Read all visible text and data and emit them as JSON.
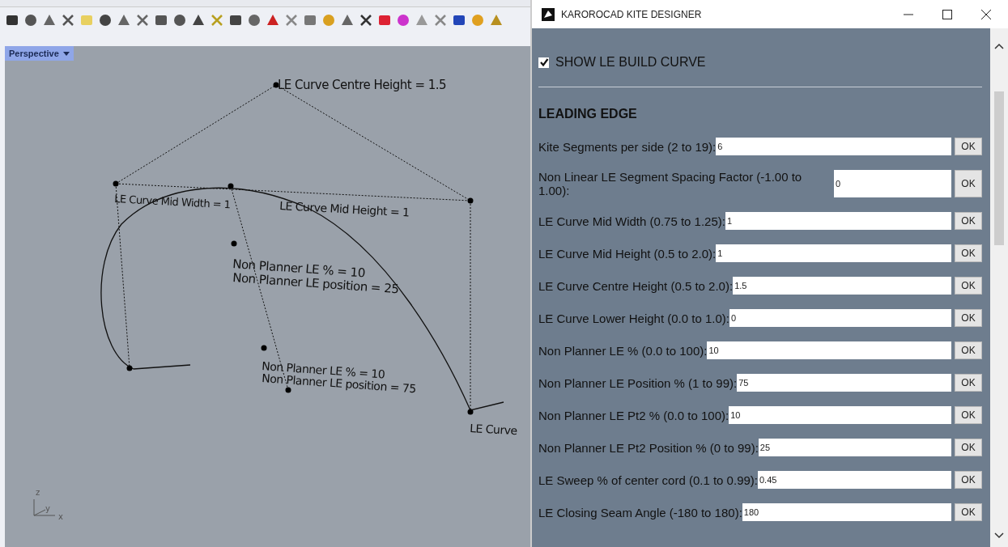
{
  "viewport": {
    "tab": "Perspective",
    "labels": [
      "LE Curve Centre Height = 1.5",
      "LE Curve Mid Width = 1",
      "LE Curve Mid Height = 1",
      "Non Planner LE % = 10",
      "Non Planner LE position = 25",
      "Non Planner LE % = 10",
      "Non Planner LE position = 75",
      "LE Curve"
    ],
    "axes": {
      "z": "z",
      "y": "y",
      "x": "x"
    }
  },
  "dialog": {
    "title": "KAROROCAD KITE DESIGNER",
    "checkbox": {
      "label": "SHOW LE BUILD CURVE",
      "checked": true
    },
    "section": "LEADING EDGE",
    "fields": [
      {
        "label": "Kite Segments per side (2 to 19):",
        "value": "6",
        "button": "OK"
      },
      {
        "label": "Non Linear LE Segment Spacing Factor (-1.00 to 1.00):",
        "value": "0",
        "button": "OK"
      },
      {
        "label": "LE Curve Mid Width (0.75 to 1.25):",
        "value": "1",
        "button": "OK"
      },
      {
        "label": "LE Curve Mid Height (0.5 to 2.0):",
        "value": "1",
        "button": "OK"
      },
      {
        "label": "LE Curve Centre Height (0.5 to 2.0):",
        "value": "1.5",
        "button": "OK"
      },
      {
        "label": "LE Curve Lower Height (0.0 to 1.0):",
        "value": "0",
        "button": "OK"
      },
      {
        "label": "Non Planner LE % (0.0 to 100):",
        "value": "10",
        "button": "OK"
      },
      {
        "label": "Non Planner LE Position % (1 to 99):",
        "value": "75",
        "button": "OK"
      },
      {
        "label": "Non Planner LE Pt2 % (0.0 to 100):",
        "value": "10",
        "button": "OK"
      },
      {
        "label": "Non Planner LE Pt2 Position % (0 to 99):",
        "value": "25",
        "button": "OK"
      },
      {
        "label": "LE Sweep % of center cord (0.1 to 0.99):",
        "value": "0.45",
        "button": "OK"
      },
      {
        "label": "LE Closing Seam Angle (-180 to 180):",
        "value": "180",
        "button": "OK"
      }
    ]
  }
}
